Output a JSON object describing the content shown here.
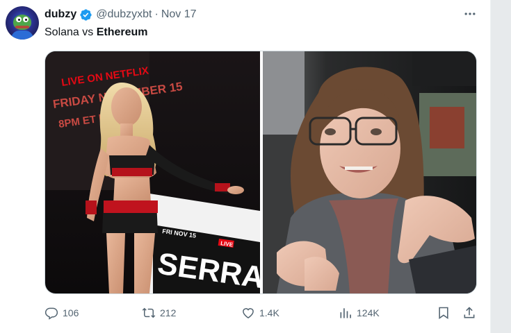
{
  "tweet": {
    "author": {
      "display_name": "dubzy",
      "handle": "@dubzyxbt",
      "verified": true,
      "avatar_icon": "pepe-frog-avatar"
    },
    "separator": "·",
    "date": "Nov 17",
    "text_plain": "Solana vs ",
    "text_bold": "Ethereum",
    "media": [
      {
        "description": "blonde ring girl in red and black outfit beside Netflix 'Serrano' boxing banner",
        "poster_lines": [
          "LIVE ON NETFLIX",
          "FRIDAY NOVEMBER 15",
          "8PM ET | 5PM PT"
        ],
        "banner_lines": [
          "FRI NOV 15",
          "LIVE",
          "SERRA"
        ]
      },
      {
        "description": "woman with glasses and long brown hair, hand on her shoulder"
      }
    ],
    "actions": {
      "reply": {
        "icon": "reply-icon",
        "count": "106"
      },
      "retweet": {
        "icon": "retweet-icon",
        "count": "212"
      },
      "like": {
        "icon": "heart-icon",
        "count": "1.4K"
      },
      "views": {
        "icon": "views-icon",
        "count": "124K"
      },
      "bookmark": {
        "icon": "bookmark-icon"
      },
      "share": {
        "icon": "share-icon"
      }
    },
    "colors": {
      "verified_blue": "#1d9bf0",
      "secondary_text": "#536471",
      "netflix_red": "#e50914"
    }
  }
}
